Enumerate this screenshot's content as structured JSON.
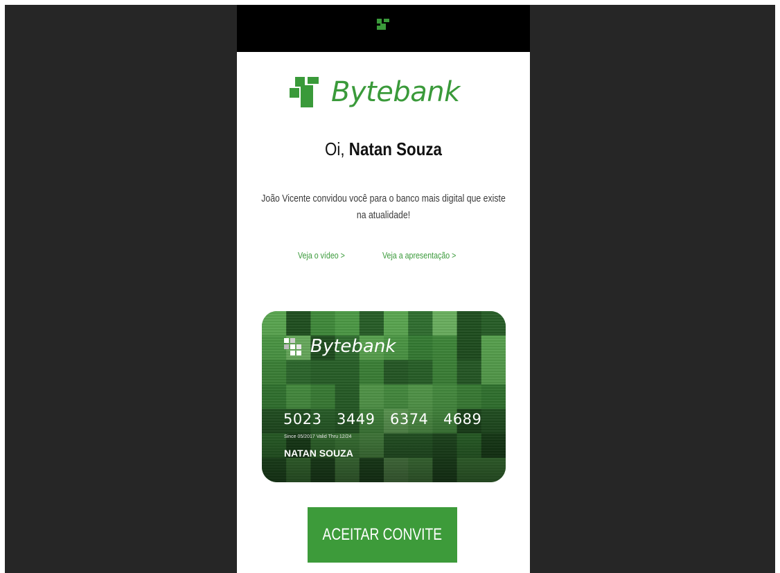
{
  "brand": {
    "name": "Bytebank",
    "color": "#3a9a3a",
    "logo_icon": "bytebank-logo-icon"
  },
  "greeting": {
    "prefix": "Oi,",
    "name": "Natan Souza"
  },
  "invite": {
    "line1": "João Vicente convidou você para o banco mais digital que existe",
    "line2": "na atualidade!"
  },
  "links": {
    "video": "Veja o vídeo >",
    "presentation": "Veja a apresentação >"
  },
  "card": {
    "brand": "Bytebank",
    "number_groups": [
      "5023",
      "3449",
      "6374",
      "4689"
    ],
    "validity": "Since 05/2017 Valid Thru 12/24",
    "holder": "NATAN SOUZA"
  },
  "actions": {
    "accept_label": "ACEITAR CONVITE",
    "accept_color": "#3d9b3a"
  }
}
